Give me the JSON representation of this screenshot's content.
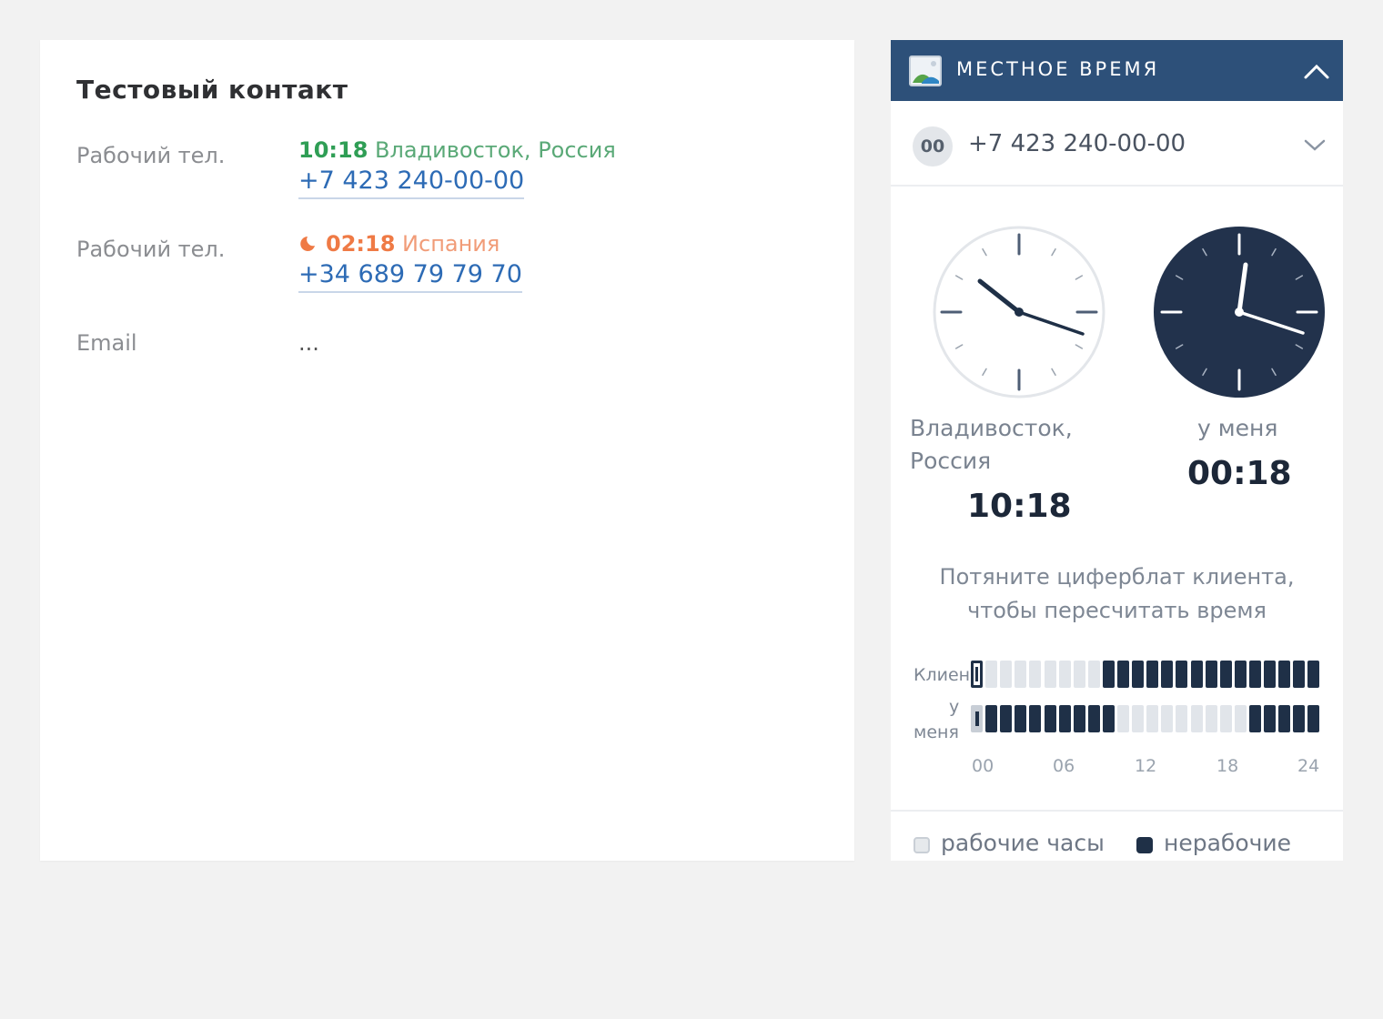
{
  "contact": {
    "name": "Тестовый контакт",
    "phone1": {
      "label": "Рабочий тел.",
      "time": "10:18",
      "place": "Владивосток, Россия",
      "number": "+7 423 240-00-00"
    },
    "phone2": {
      "label": "Рабочий тел.",
      "time": "02:18",
      "place": "Испания",
      "number": "+34 689 79 79 70",
      "icon": "moon-icon"
    },
    "email": {
      "label": "Email",
      "value": "..."
    }
  },
  "panel": {
    "title": "МЕСТНОЕ ВРЕМЯ",
    "selector": {
      "badge": "00",
      "value": "+7 423 240-00-00"
    },
    "client_clock": {
      "label_line1": "Владивосток,",
      "label_line2": "Россия",
      "time": "10:18"
    },
    "my_clock": {
      "label": "у меня",
      "time": "00:18"
    },
    "hint_line1": "Потяните циферблат клиента,",
    "hint_line2": "чтобы пересчитать время",
    "hours": {
      "client_label": "Клиен",
      "me_label_line1": "у",
      "me_label_line2": "меня",
      "axis": [
        "00",
        "06",
        "12",
        "18",
        "24"
      ],
      "client_off_hours": [
        9,
        10,
        11,
        12,
        13,
        14,
        15,
        16,
        17,
        18,
        19,
        20,
        21,
        22,
        23
      ],
      "me_off_hours": [
        1,
        2,
        3,
        4,
        5,
        6,
        7,
        8,
        9,
        19,
        20,
        21,
        22,
        23
      ]
    },
    "legend": {
      "work": "рабочие часы",
      "off": "нерабочие"
    }
  },
  "colors": {
    "header_bg": "#2d5079",
    "green": "#2f9e55",
    "orange": "#ef7a45",
    "link": "#2d6bb5",
    "dark": "#1f3047"
  }
}
